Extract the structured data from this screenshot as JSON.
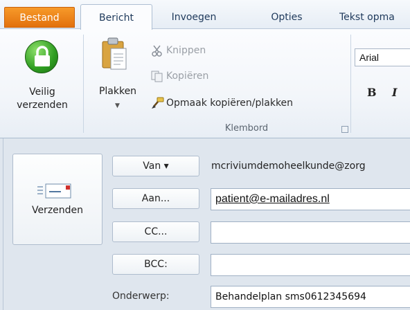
{
  "tabs": [
    {
      "label": "Bestand"
    },
    {
      "label": "Bericht"
    },
    {
      "label": "Invoegen"
    },
    {
      "label": "Opties"
    },
    {
      "label": "Tekst opma"
    }
  ],
  "ribbon": {
    "veilig": {
      "line1": "Veilig",
      "line2": "verzenden"
    },
    "paste": {
      "label": "Plakken"
    },
    "clipboard_actions": {
      "cut": "Knippen",
      "copy": "Kopiëren",
      "format_painter": "Opmaak kopiëren/plakken"
    },
    "group_label": "Klembord",
    "font_name": "Arial",
    "bold": "B",
    "italic": "I"
  },
  "compose": {
    "send_label": "Verzenden",
    "from_button": "Van ▾",
    "from_value": "mcriviumdemoheelkunde@zorg",
    "to_button": "Aan...",
    "to_value": "patient@e-mailadres.nl",
    "cc_button": "CC...",
    "cc_value": "",
    "bcc_button": "BCC:",
    "bcc_value": "",
    "subject_label": "Onderwerp:",
    "subject_value": "Behandelplan sms0612345694"
  },
  "colors": {
    "file_tab": "#e2710d",
    "lock_green": "#2f9d21",
    "send_flag": "#d0312d"
  }
}
